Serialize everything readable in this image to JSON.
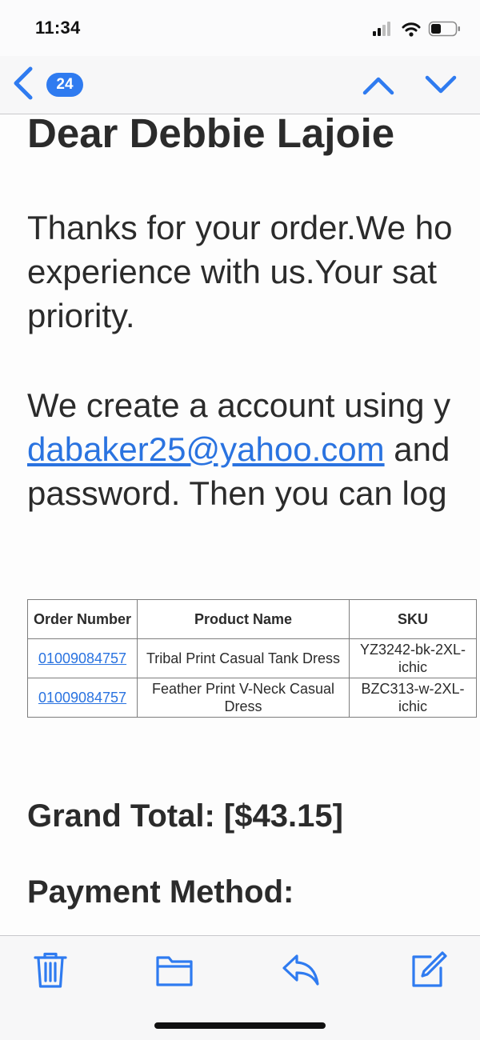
{
  "status_bar": {
    "time": "11:34"
  },
  "nav": {
    "unread_count": "24"
  },
  "email": {
    "greeting": "Dear Debbie Lajoie",
    "para1_lines": [
      "Thanks for your order.We ho",
      "experience with us.Your sat",
      "priority."
    ],
    "para2_line1": "We create a account using y",
    "email_link": "dabaker25@yahoo.com",
    "para2_line2_tail": " and",
    "para2_line3": "password. Then you can log"
  },
  "orders_table": {
    "headers": [
      "Order Number",
      "Product Name",
      "SKU"
    ],
    "rows": [
      {
        "order_number": "01009084757",
        "product_name": "Tribal Print Casual Tank Dress",
        "sku": "YZ3242-bk-2XL-ichic"
      },
      {
        "order_number": "01009084757",
        "product_name": "Feather Print V-Neck Casual Dress",
        "sku": "BZC313-w-2XL-ichic"
      }
    ]
  },
  "summary": {
    "grand_total": "Grand Total: [$43.15]",
    "payment_method": "Payment Method:"
  },
  "colors": {
    "accent": "#2f7bf0",
    "link": "#2a73e0",
    "text": "#2b2b2b"
  },
  "icons": [
    "back-chevron-icon",
    "chevron-up-icon",
    "chevron-down-icon",
    "trash-icon",
    "folder-icon",
    "reply-icon",
    "compose-icon"
  ]
}
